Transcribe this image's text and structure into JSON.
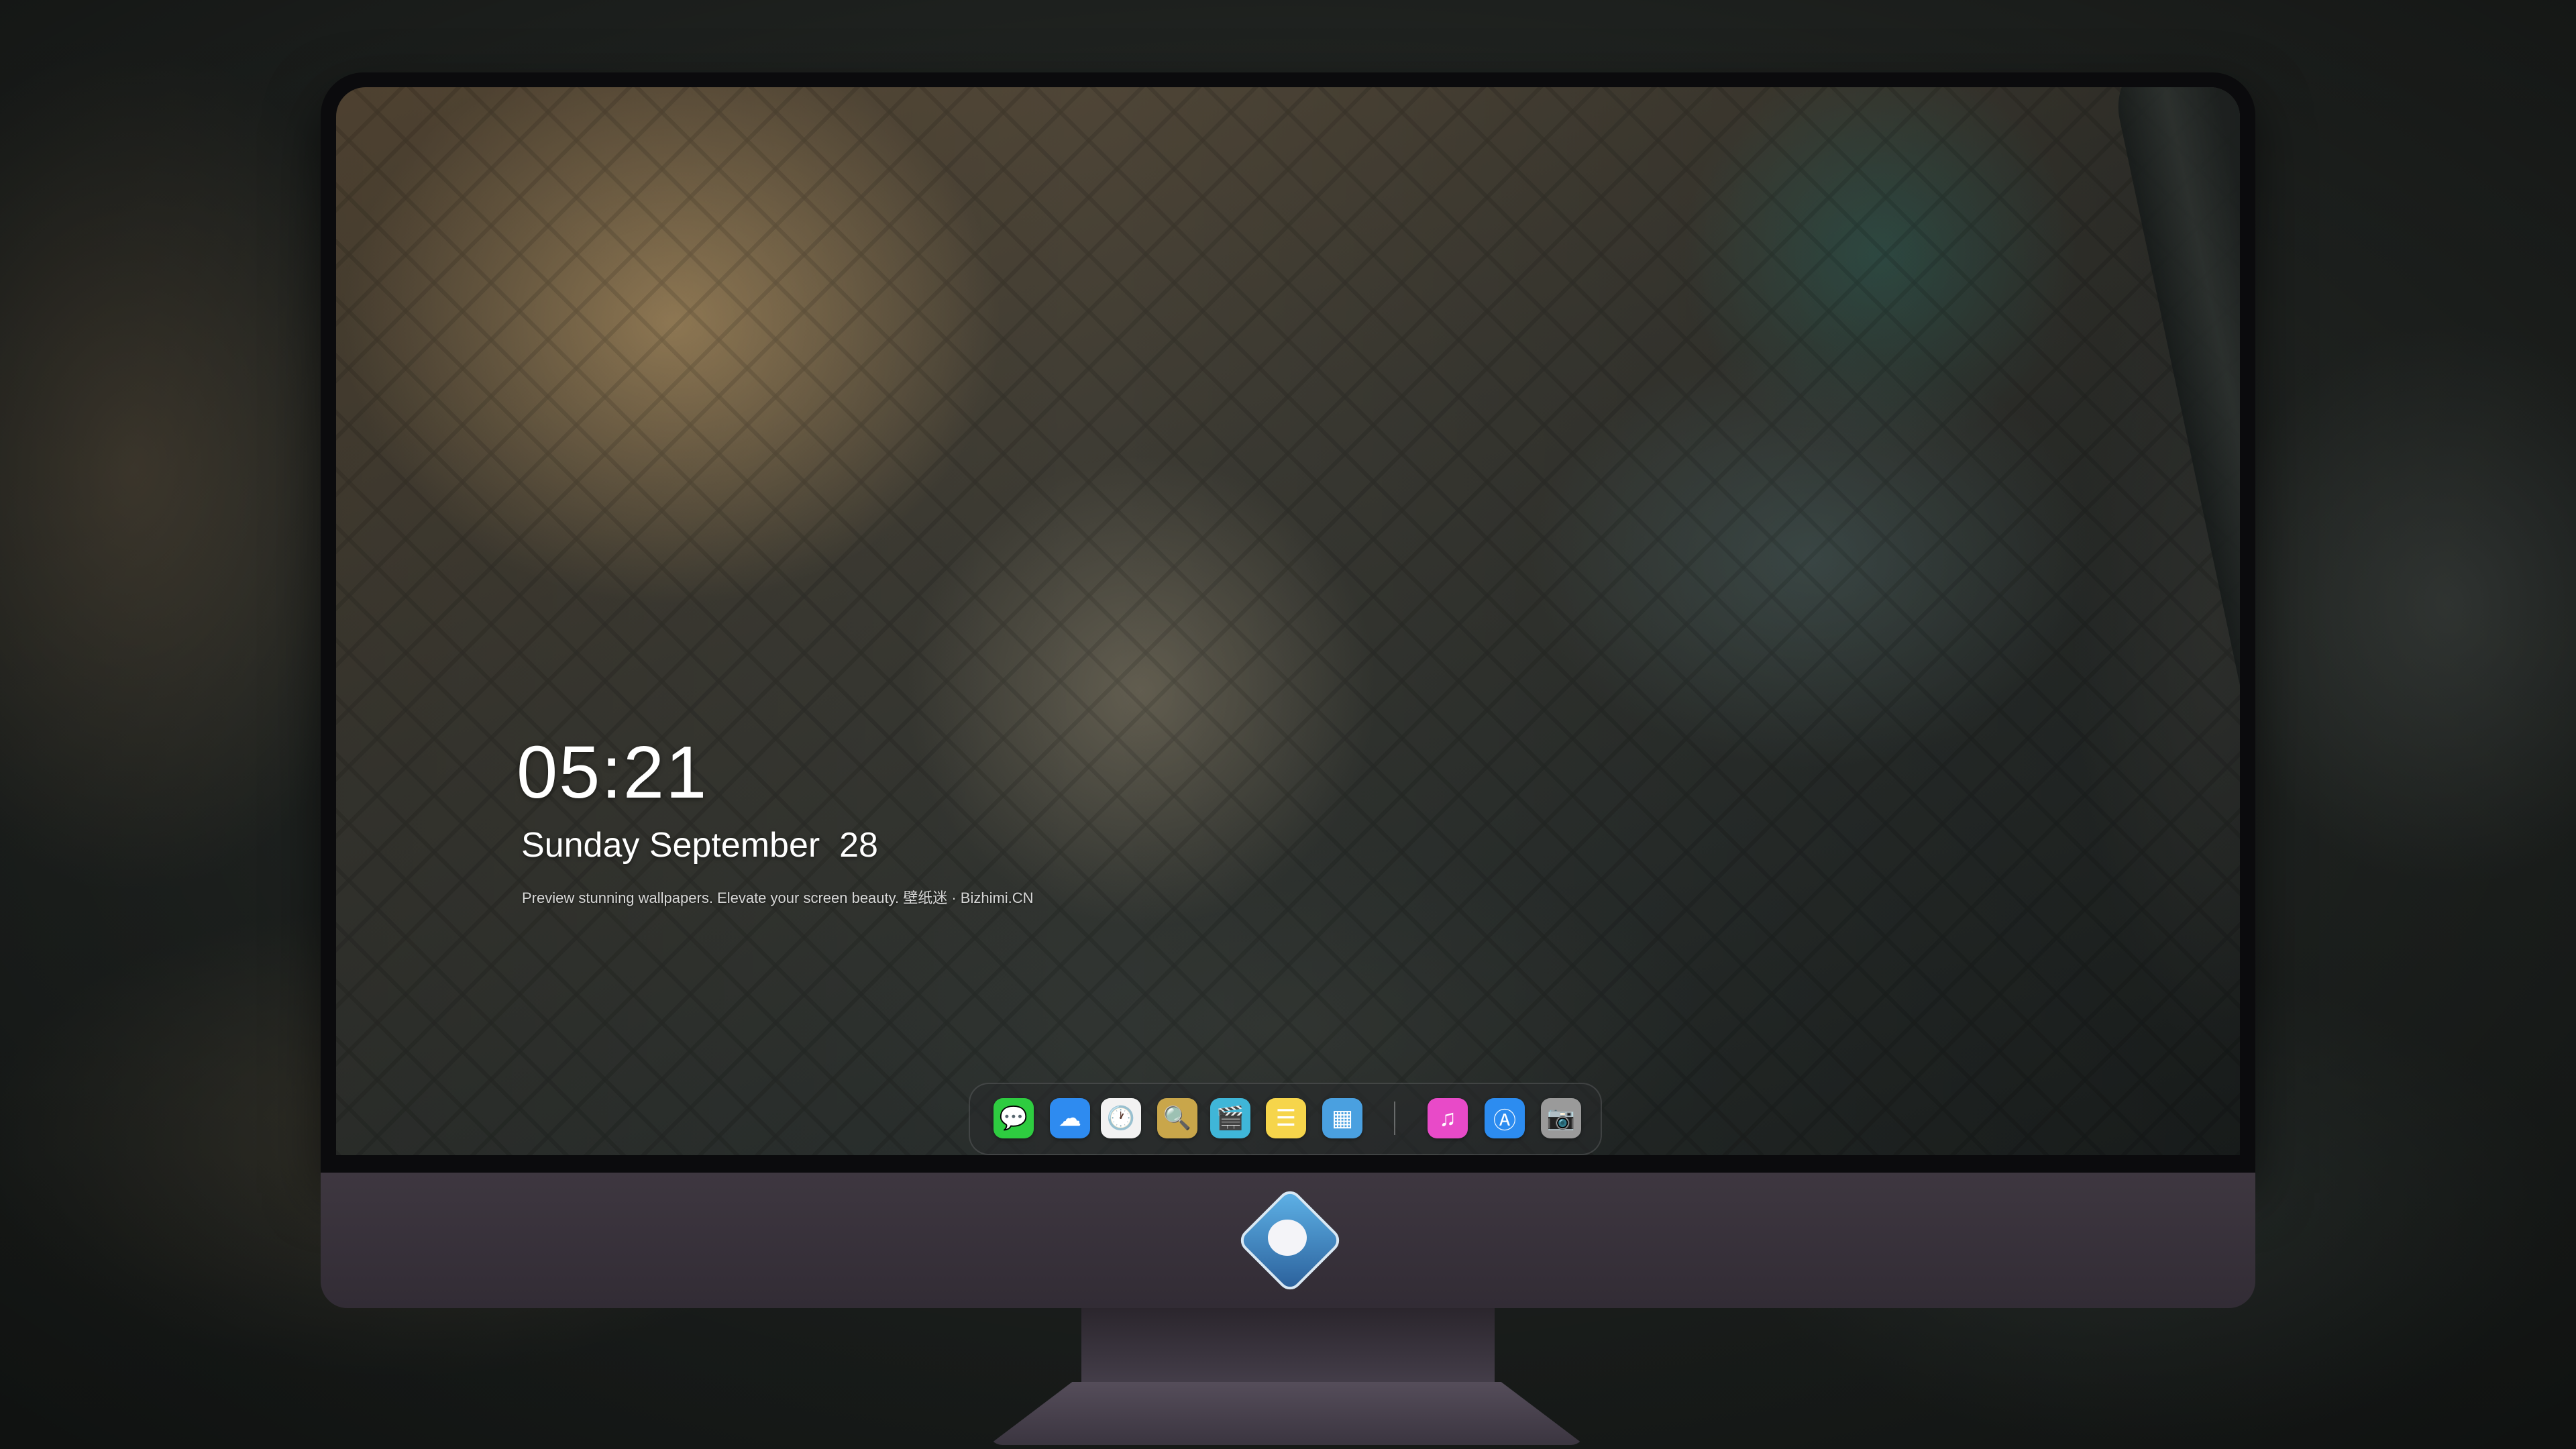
{
  "lock_screen": {
    "time": "05:21",
    "date": "Sunday September  28",
    "tagline": "Preview stunning wallpapers. Elevate your screen beauty. 壁纸迷 · Bizhimi.CN"
  },
  "dock": {
    "apps": [
      {
        "name": "messages-icon",
        "glyph": "💬",
        "color": "#2ecc40"
      },
      {
        "name": "weather-icon",
        "glyph": "☁",
        "color": "#2e8bf0"
      },
      {
        "name": "clock-icon",
        "glyph": "🕐",
        "color": "#f2f2f2"
      },
      {
        "name": "preview-icon",
        "glyph": "🔍",
        "color": "#c9a64a"
      },
      {
        "name": "video-icon",
        "glyph": "🎬",
        "color": "#3fb6d8"
      },
      {
        "name": "notes-icon",
        "glyph": "☰",
        "color": "#f6d54b"
      },
      {
        "name": "photos-icon",
        "glyph": "▦",
        "color": "#4aa0e0"
      },
      {
        "name": "music-icon",
        "glyph": "♫",
        "color": "#e84ac8"
      },
      {
        "name": "app-store-icon",
        "glyph": "Ⓐ",
        "color": "#2c8cf0"
      },
      {
        "name": "camera-icon",
        "glyph": "📷",
        "color": "#9a9a9a"
      }
    ]
  },
  "colors": {
    "chin": "#3e3740",
    "bezel": "#0b0b0d",
    "text": "#ffffff"
  }
}
